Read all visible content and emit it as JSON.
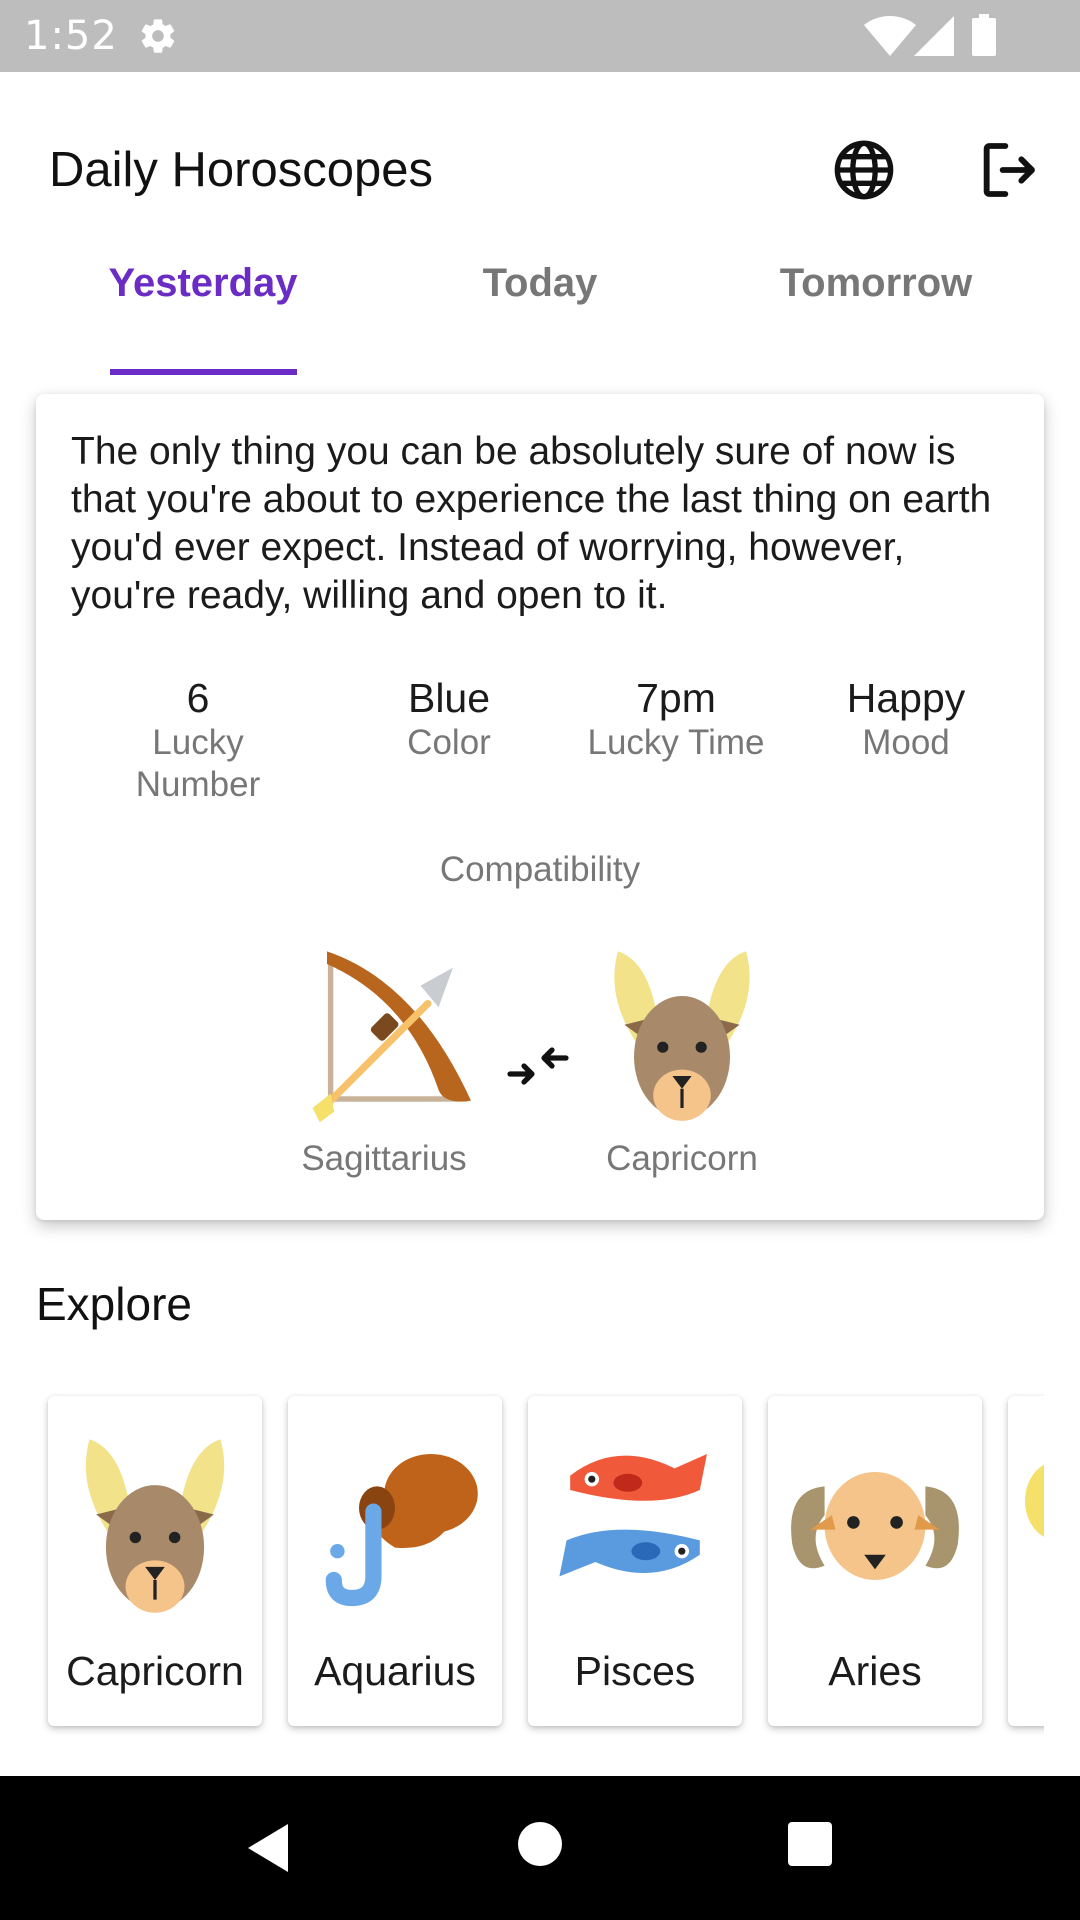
{
  "status_bar": {
    "time": "1:52"
  },
  "app_bar": {
    "title": "Daily Horoscopes",
    "icons": [
      "globe-icon",
      "logout-icon"
    ]
  },
  "tabs": [
    {
      "label": "Yesterday",
      "active": true
    },
    {
      "label": "Today",
      "active": false
    },
    {
      "label": "Tomorrow",
      "active": false
    }
  ],
  "horoscope": {
    "text": "The only thing you can be absolutely sure of now is that you're about to experience the last thing on earth you'd ever expect. Instead of worrying, however, you're ready, willing and open to it.",
    "stats": [
      {
        "value": "6",
        "label": "Lucky Number"
      },
      {
        "value": "Blue",
        "label": "Color"
      },
      {
        "value": "7pm",
        "label": "Lucky Time"
      },
      {
        "value": "Happy",
        "label": "Mood"
      }
    ],
    "compatibility": {
      "title": "Compatibility",
      "sign_a": "Sagittarius",
      "sign_b": "Capricorn"
    }
  },
  "explore": {
    "title": "Explore",
    "signs": [
      "Capricorn",
      "Aquarius",
      "Pisces",
      "Aries"
    ]
  },
  "colors": {
    "accent": "#6a2cc4",
    "text_primary": "#1b1b1b",
    "text_secondary": "#777777",
    "status_bar": "#bdbdbd",
    "nav_bar": "#000000"
  }
}
